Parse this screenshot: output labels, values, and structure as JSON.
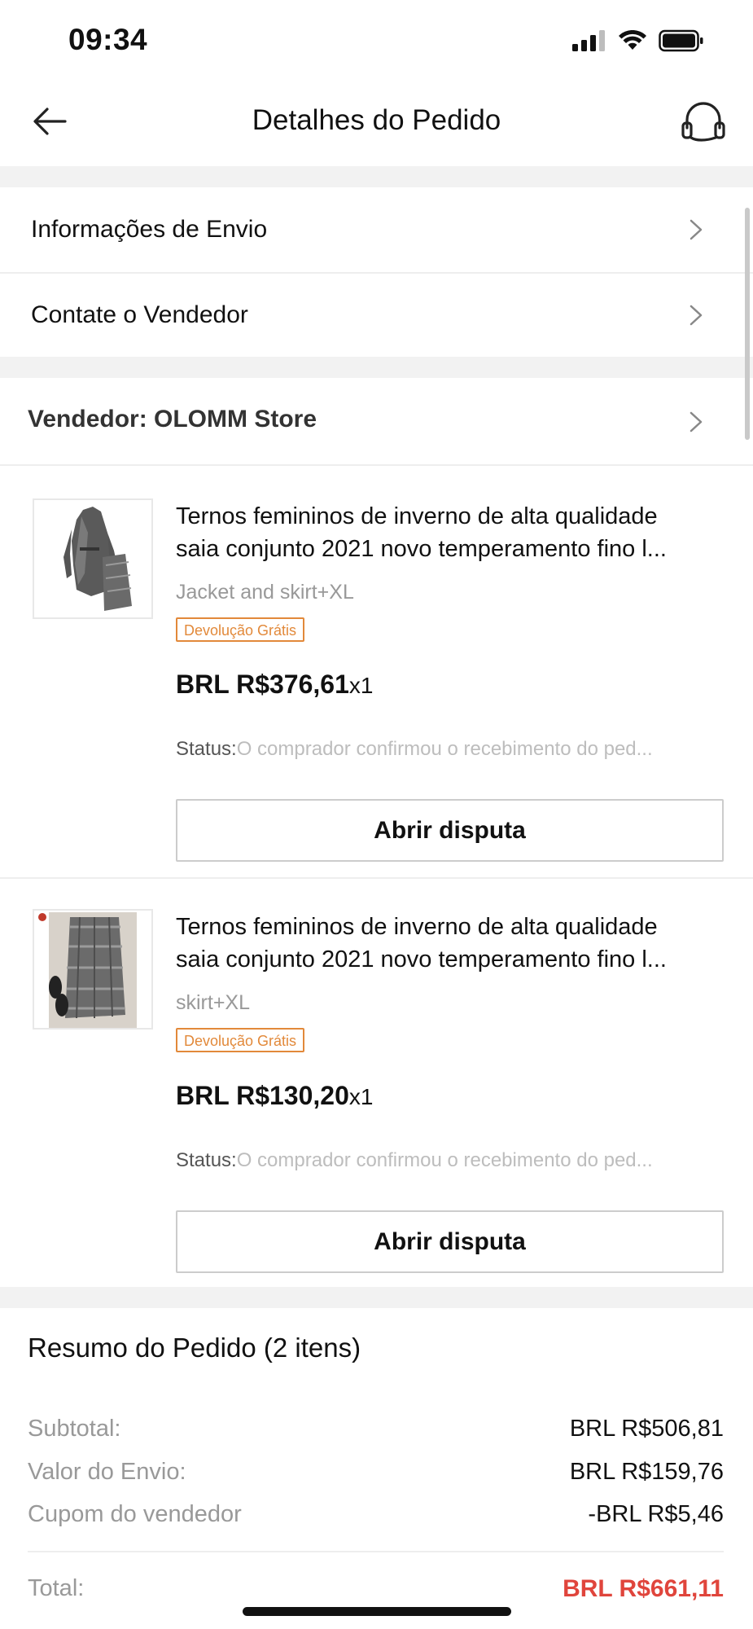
{
  "status_bar": {
    "time": "09:34"
  },
  "header": {
    "title": "Detalhes do Pedido"
  },
  "links": {
    "shipping_info": "Informações de Envio",
    "contact_seller": "Contate o Vendedor"
  },
  "seller": {
    "label": "Vendedor: OLOMM Store"
  },
  "items": [
    {
      "title_line1": "Ternos femininos de inverno de alta qualidade",
      "title_line2": "saia conjunto 2021 novo temperamento fino l...",
      "variant": "Jacket and skirt+XL",
      "badge": "Devolução Grátis",
      "price": "BRL R$376,61",
      "qty": "x1",
      "status_label": "Status:",
      "status_value": "O comprador confirmou o recebimento do ped...",
      "button": "Abrir disputa"
    },
    {
      "title_line1": "Ternos femininos de inverno de alta qualidade",
      "title_line2": "saia conjunto 2021 novo temperamento fino l...",
      "variant": "skirt+XL",
      "badge": "Devolução Grátis",
      "price": "BRL R$130,20",
      "qty": "x1",
      "status_label": "Status:",
      "status_value": "O comprador confirmou o recebimento do ped...",
      "button": "Abrir disputa"
    }
  ],
  "summary": {
    "title": "Resumo do Pedido (2 itens)",
    "subtotal_label": "Subtotal:",
    "subtotal_value": "BRL R$506,81",
    "shipping_label": "Valor do Envio:",
    "shipping_value": "BRL R$159,76",
    "coupon_label": "Cupom do vendedor",
    "coupon_value": "-BRL R$5,46",
    "total_label": "Total:",
    "total_value": "BRL R$661,11"
  },
  "colors": {
    "accent_total": "#e0453c",
    "badge": "#e2893a",
    "separator": "#f2f2f2"
  }
}
